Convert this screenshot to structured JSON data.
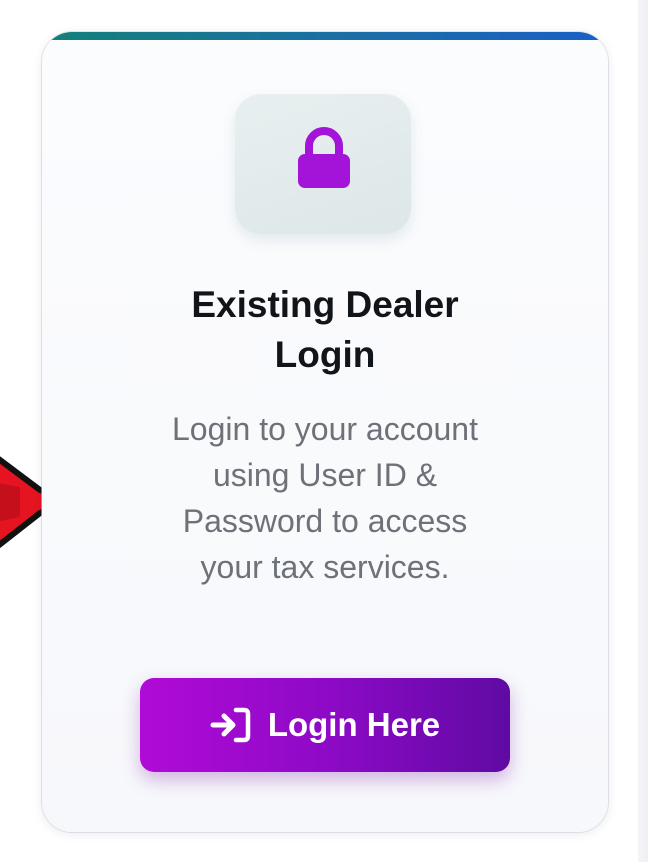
{
  "colors": {
    "card_top_gradient_start": "#14807a",
    "card_top_gradient_end": "#1b5fc6",
    "icon_tile_bg": "#e3ecec",
    "lock_color": "#a313d8",
    "title_color": "#111418",
    "description_color": "#6d7178",
    "button_gradient_start": "#b10ad8",
    "button_gradient_end": "#5f0aa3",
    "arrow_color": "#e51420"
  },
  "card": {
    "icon": "lock-icon",
    "title_lines": [
      "Existing Dealer",
      "Login"
    ],
    "description_lines": [
      "Login to your account",
      "using User ID &",
      "Password to access",
      "your tax services."
    ],
    "button": {
      "icon": "sign-in-icon",
      "label": "Login Here"
    }
  }
}
